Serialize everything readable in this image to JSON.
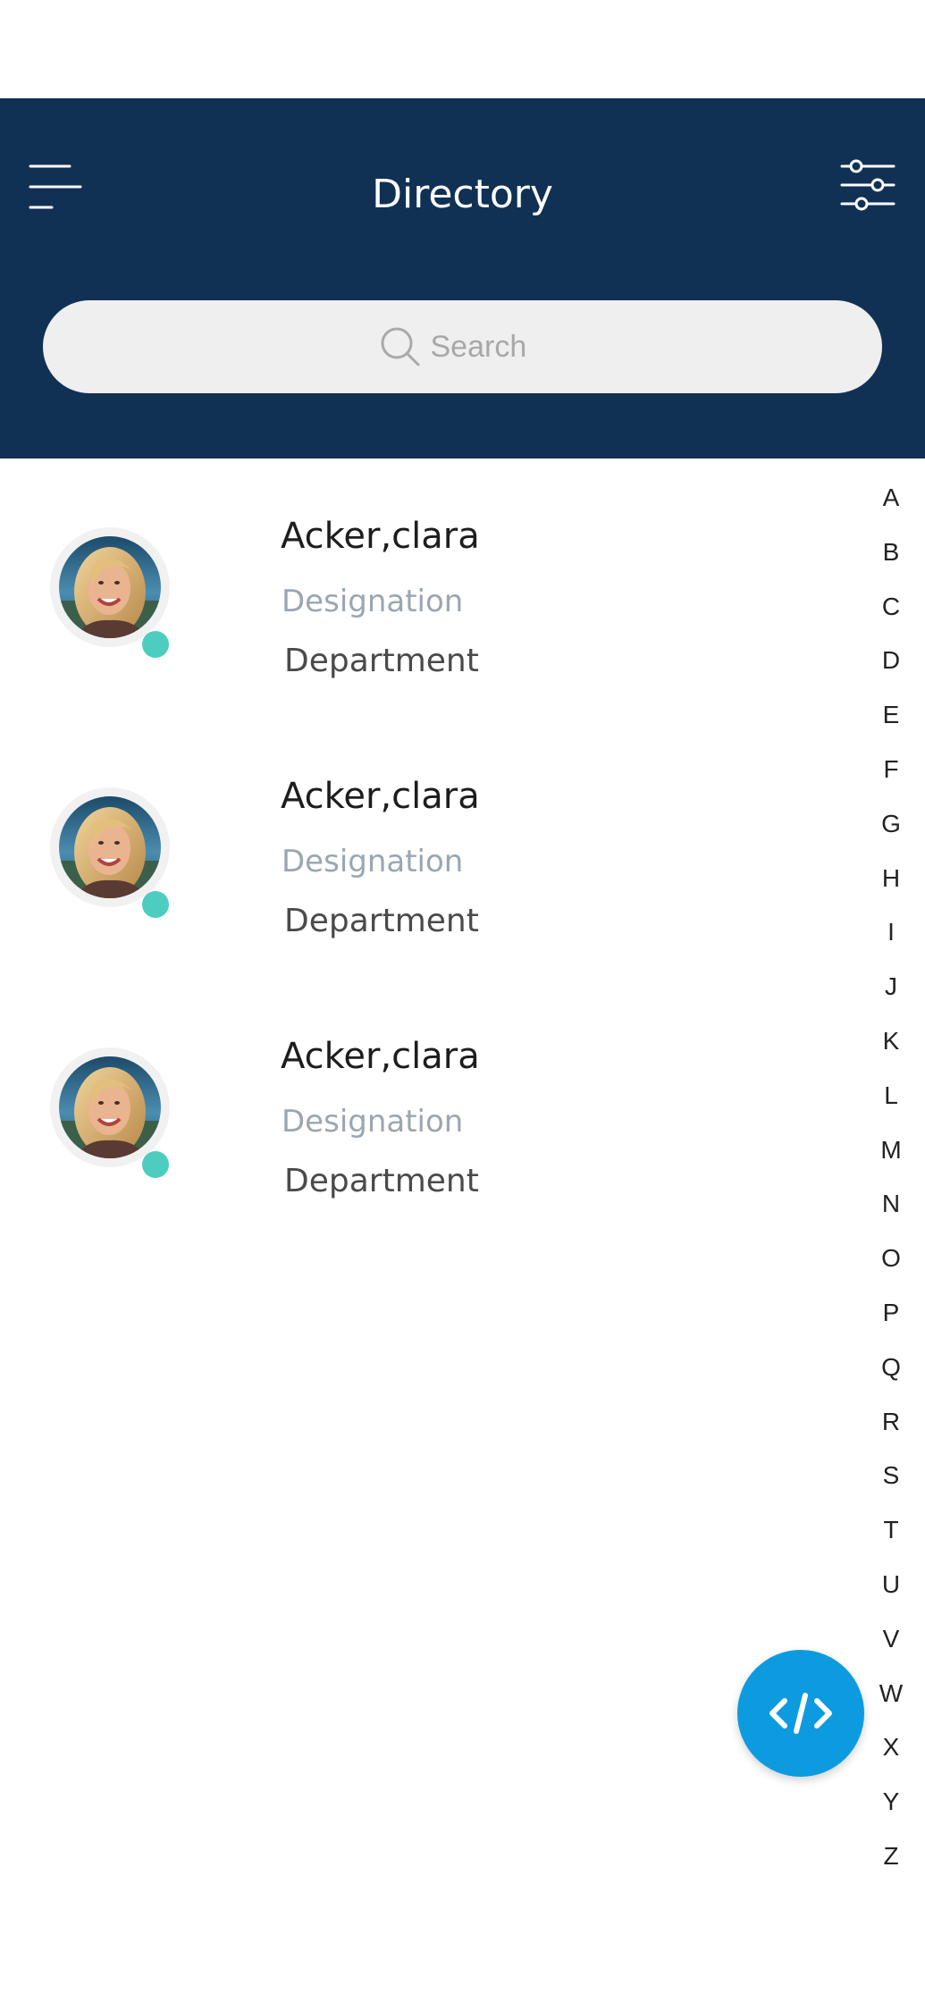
{
  "header": {
    "title": "Directory",
    "background_color": "#113154"
  },
  "search": {
    "placeholder": "Search"
  },
  "contacts": [
    {
      "name": "Acker,clara",
      "designation": "Designation",
      "department": "Department",
      "status": "online"
    },
    {
      "name": "Acker,clara",
      "designation": "Designation",
      "department": "Department",
      "status": "online"
    },
    {
      "name": "Acker,clara",
      "designation": "Designation",
      "department": "Department",
      "status": "online"
    }
  ],
  "alphabet": [
    "A",
    "B",
    "C",
    "D",
    "E",
    "F",
    "G",
    "H",
    "I",
    "J",
    "K",
    "L",
    "M",
    "N",
    "O",
    "P",
    "Q",
    "R",
    "S",
    "T",
    "U",
    "V",
    "W",
    "X",
    "Y",
    "Z"
  ],
  "colors": {
    "status_online": "#4ccdbf",
    "fab": "#0d9be0"
  },
  "icons": {
    "menu": "hamburger-menu-icon",
    "filter": "sliders-filter-icon",
    "search": "search-icon",
    "fab": "code-icon"
  }
}
